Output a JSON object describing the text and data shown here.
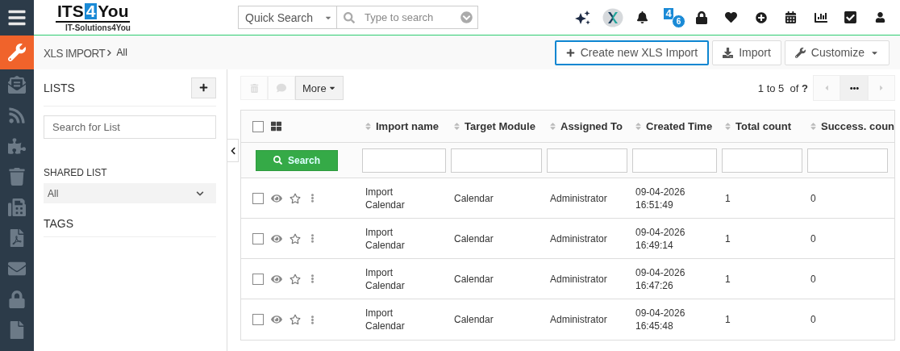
{
  "logo": {
    "parts": [
      "ITS",
      "4",
      "You"
    ],
    "tagline": "IT-Solutions4You"
  },
  "quick_search": {
    "module": "Quick Search",
    "placeholder": "Type to search"
  },
  "notification": {
    "label": "4",
    "count": "6"
  },
  "breadcrumb": {
    "module": "XLS IMPORT",
    "view": "All"
  },
  "actions": [
    {
      "kind": "create",
      "label": "Create new XLS Import",
      "focused": true
    },
    {
      "kind": "import",
      "label": "Import",
      "focused": false
    },
    {
      "kind": "customize",
      "label": "Customize",
      "focused": false
    }
  ],
  "sidebar": {
    "lists_title": "LISTS",
    "search_placeholder": "Search for List",
    "shared_title": "SHARED LIST",
    "shared_value": "All",
    "tags_title": "TAGS"
  },
  "toolbar": {
    "buttons": [
      {
        "kind": "delete",
        "disabled": true
      },
      {
        "kind": "comment",
        "disabled": true
      }
    ],
    "more": "More",
    "range": "1 to 5",
    "total": "of **?**"
  },
  "table": {
    "columns": [
      "Import name",
      "Target Module",
      "Assigned To",
      "Created Time",
      "Total count",
      "Success. coun"
    ],
    "search_button": "Search",
    "select_all_checked": false,
    "rows": [
      {
        "checked": false,
        "starred": false,
        "cells": [
          "Import Calendar",
          "Calendar",
          "Administrator",
          "09-04-2026 16:51:49",
          "1",
          "0"
        ]
      },
      {
        "checked": false,
        "starred": false,
        "cells": [
          "Import Calendar",
          "Calendar",
          "Administrator",
          "09-04-2026 16:49:14",
          "1",
          "0"
        ]
      },
      {
        "checked": false,
        "starred": false,
        "cells": [
          "Import Calendar",
          "Calendar",
          "Administrator",
          "09-04-2026 16:47:26",
          "1",
          "0"
        ]
      },
      {
        "checked": false,
        "starred": false,
        "cells": [
          "Import Calendar",
          "Calendar",
          "Administrator",
          "09-04-2026 16:45:48",
          "1",
          "0"
        ]
      }
    ]
  }
}
